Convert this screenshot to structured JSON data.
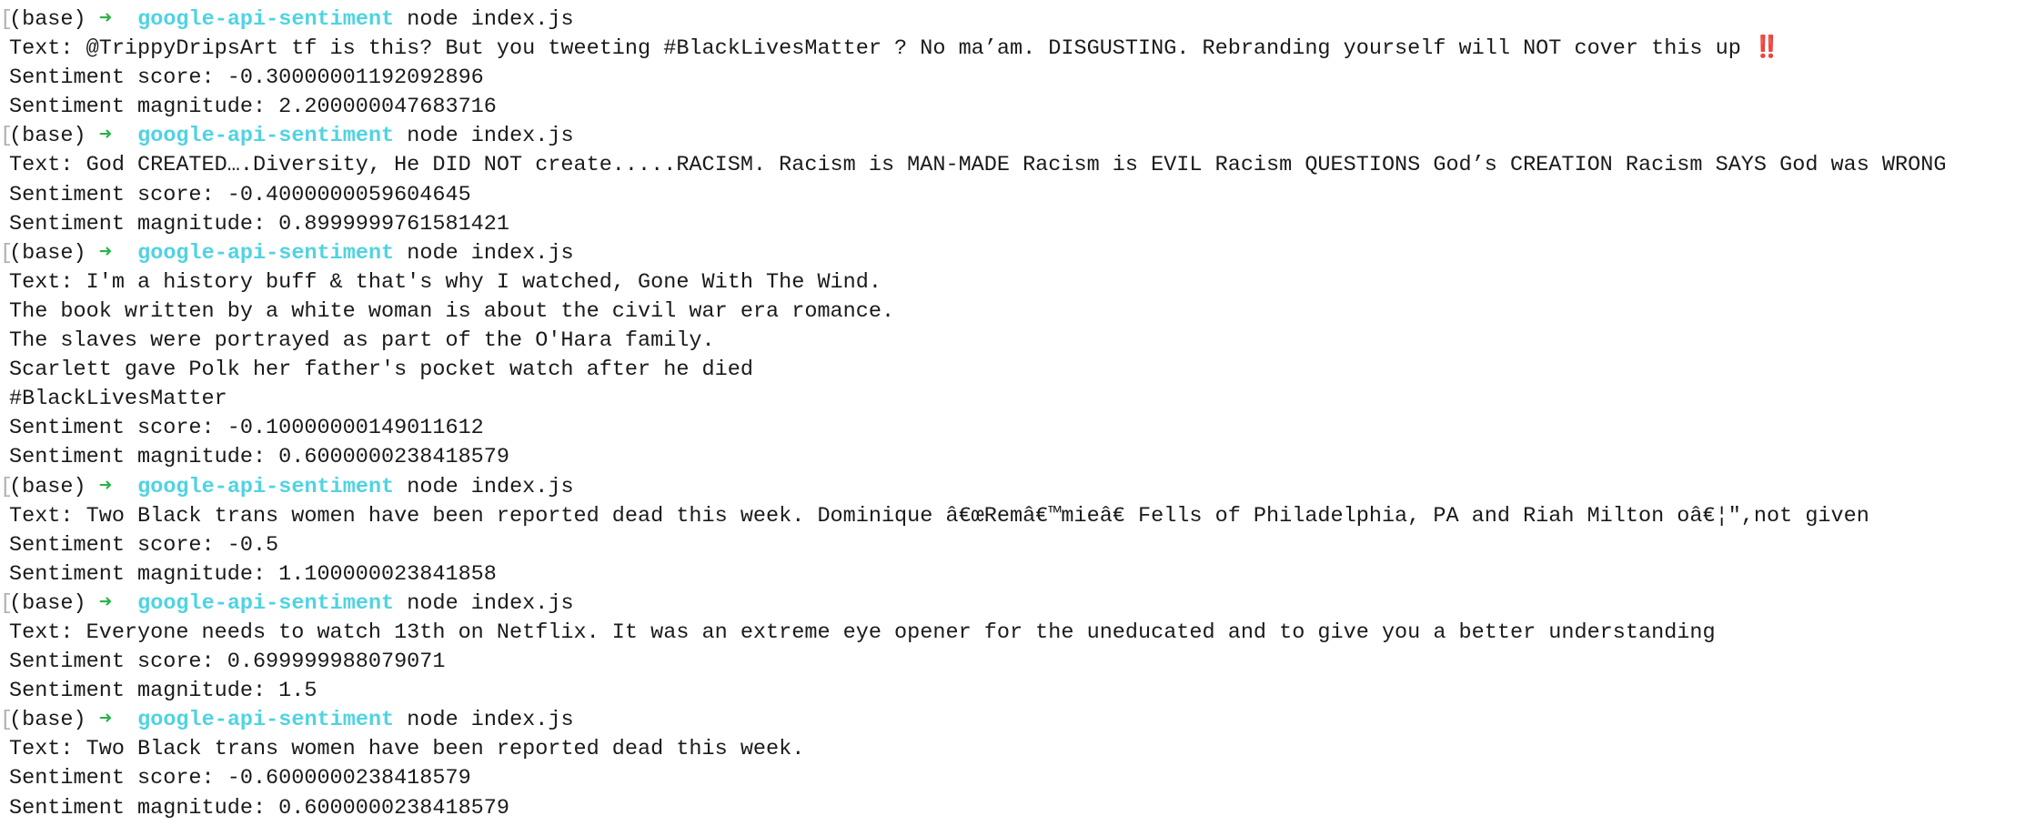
{
  "terminal": {
    "prompt_bracket": "[",
    "prompt_env": "(base)",
    "prompt_arrow": "➜",
    "prompt_dir": "google-api-sentiment",
    "prompt_command": "node index.js",
    "emoji_double_exclamation": "‼️",
    "blocks": [
      {
        "text_lines": [
          "Text: @TrippyDripsArt tf is this? But you tweeting #BlackLivesMatter ? No ma’am. DISGUSTING. Rebranding yourself will NOT cover this up "
        ],
        "score": "Sentiment score: -0.30000001192092896",
        "magnitude": "Sentiment magnitude: 2.200000047683716"
      },
      {
        "text_lines": [
          "Text: God CREATED….Diversity, He DID NOT create.....RACISM. Racism is MAN-MADE Racism is EVIL Racism QUESTIONS God’s CREATION Racism SAYS God was WRONG"
        ],
        "score": "Sentiment score: -0.4000000059604645",
        "magnitude": "Sentiment magnitude: 0.8999999761581421"
      },
      {
        "text_lines": [
          "Text: I'm a history buff & that's why I watched, Gone With The Wind.",
          "The book written by a white woman is about the civil war era romance.",
          "The slaves were portrayed as part of the O'Hara family.",
          "Scarlett gave Polk her father's pocket watch after he died",
          "#BlackLivesMatter"
        ],
        "score": "Sentiment score: -0.10000000149011612",
        "magnitude": "Sentiment magnitude: 0.6000000238418579"
      },
      {
        "text_lines": [
          "Text: Two Black trans women have been reported dead this week. Dominique â€œRemâ€™mieâ€ Fells of Philadelphia, PA and Riah Milton oâ€¦\",not given"
        ],
        "score": "Sentiment score: -0.5",
        "magnitude": "Sentiment magnitude: 1.100000023841858"
      },
      {
        "text_lines": [
          "Text: Everyone needs to watch 13th on Netflix. It was an extreme eye opener for the uneducated and to give you a better understanding"
        ],
        "score": "Sentiment score: 0.699999988079071",
        "magnitude": "Sentiment magnitude: 1.5"
      },
      {
        "text_lines": [
          "Text: Two Black trans women have been reported dead this week."
        ],
        "score": "Sentiment score: -0.6000000238418579",
        "magnitude": "Sentiment magnitude: 0.6000000238418579"
      }
    ]
  }
}
